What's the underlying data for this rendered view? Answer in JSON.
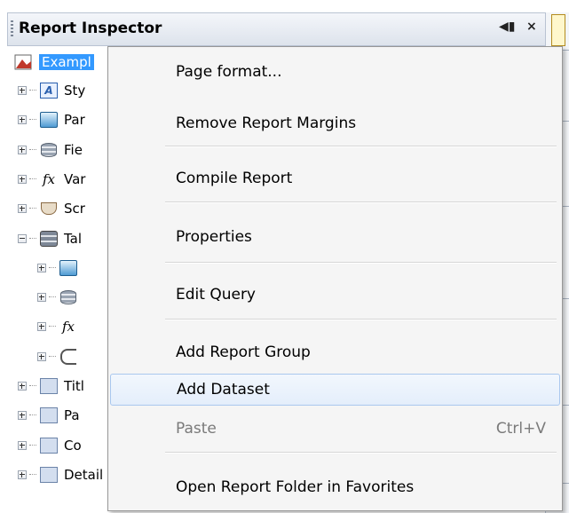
{
  "panel": {
    "title": "Report Inspector",
    "pin_glyph": "◀▮",
    "close_glyph": "×"
  },
  "root": {
    "label": "Exampl",
    "icon": "report-document-icon"
  },
  "tree": [
    {
      "label": "Sty",
      "icon": "styles-icon",
      "indent": 0
    },
    {
      "label": "Par",
      "icon": "parameters-icon",
      "indent": 0
    },
    {
      "label": "Fie",
      "icon": "fields-database-icon",
      "indent": 0
    },
    {
      "label": "Var",
      "icon": "function-fx-icon",
      "indent": 0
    },
    {
      "label": "Scr",
      "icon": "scriptlets-cup-icon",
      "indent": 0
    },
    {
      "label": "Tal",
      "icon": "table-dataset-icon",
      "indent": 0,
      "expanded": true
    },
    {
      "label": "",
      "icon": "parameters-icon",
      "indent": 1
    },
    {
      "label": "",
      "icon": "fields-database-icon",
      "indent": 1
    },
    {
      "label": "",
      "icon": "function-fx-icon",
      "indent": 1
    },
    {
      "label": "",
      "icon": "crosstab-icon",
      "indent": 1
    },
    {
      "label": "Titl",
      "icon": "band-icon",
      "indent": 0
    },
    {
      "label": "Pa",
      "icon": "band-icon",
      "indent": 0
    },
    {
      "label": "Co",
      "icon": "band-icon",
      "indent": 0
    },
    {
      "label": "Detail",
      "icon": "band-icon",
      "indent": 0
    }
  ],
  "menu": {
    "items": [
      {
        "label": "Page format...",
        "shortcut": "",
        "enabled": true
      },
      {
        "label": "Remove Report Margins",
        "shortcut": "",
        "enabled": true
      },
      {
        "label": "Compile Report",
        "shortcut": "",
        "enabled": true
      },
      {
        "label": "Properties",
        "shortcut": "",
        "enabled": true
      },
      {
        "label": "Edit Query",
        "shortcut": "",
        "enabled": true
      },
      {
        "label": "Add Report Group",
        "shortcut": "",
        "enabled": true
      },
      {
        "label": "Add Dataset",
        "shortcut": "",
        "enabled": true,
        "hovered": true
      },
      {
        "label": "Paste",
        "shortcut": "Ctrl+V",
        "enabled": false
      },
      {
        "label": "Open Report Folder in Favorites",
        "shortcut": "",
        "enabled": true
      }
    ]
  },
  "colors": {
    "selection": "#3399ff",
    "menu_bg": "#f5f5f5",
    "hover_border": "#a9c7ee"
  }
}
